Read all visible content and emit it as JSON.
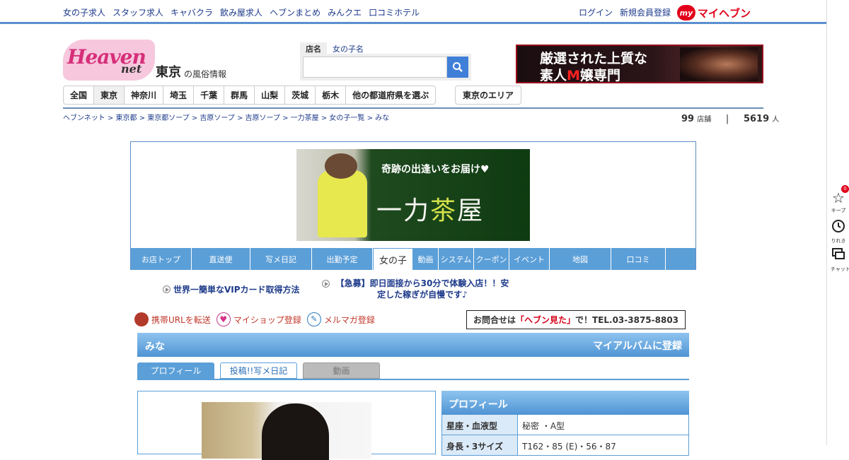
{
  "top_nav": {
    "links": [
      "女の子求人",
      "スタッフ求人",
      "キャバクラ",
      "飲み屋求人",
      "ヘブンまとめ",
      "みんクエ",
      "口コミホテル"
    ],
    "login": "ログイン",
    "register": "新規会員登録",
    "my_badge": "my",
    "my_heaven": "マイヘブン"
  },
  "header": {
    "logo_text": "Heaven",
    "logo_net": "net",
    "city": "東京",
    "city_sub": "の風俗情報",
    "search_tabs": [
      "店名",
      "女の子名"
    ],
    "search_placeholder": "",
    "ad_line1_a": "厳選された",
    "ad_line1_b": "上質な",
    "ad_line2_a": "素人",
    "ad_line2_b": "M",
    "ad_line2_c": "嬢専門"
  },
  "regions": {
    "items": [
      "全国",
      "東京",
      "神奈川",
      "埼玉",
      "千葉",
      "群馬",
      "山梨",
      "茨城",
      "栃木",
      "他の都道府県を選ぶ"
    ],
    "active": "東京",
    "area_button": "東京のエリア"
  },
  "breadcrumb": "ヘブンネット > 東京都 > 東京都ソープ > 吉原ソープ > 吉原ソープ > 一力茶屋 > 女の子一覧 > みな",
  "counts": {
    "shops": "99",
    "shops_unit": "店舗",
    "sep": "|",
    "people": "5619",
    "people_unit": "人"
  },
  "shop": {
    "tagline": "奇跡の出逢いをお届け♥",
    "name_a": "一力",
    "name_b": "茶",
    "name_c": "屋",
    "menu": [
      "お店トップ",
      "直送便",
      "写メ日記",
      "出勤予定",
      "女の子",
      "動画",
      "システム",
      "クーポン",
      "イベント",
      "地図",
      "口コミ"
    ],
    "active_menu": "女の子"
  },
  "announcements": {
    "vip": "世界一簡単なVIPカード取得方法",
    "urgent": "【急募】即日面接から30分で体験入店！！安定した稼ぎが自慢です♪"
  },
  "actions": {
    "mobile_url": "携帯URLを転送",
    "my_shop": "マイショップ登録",
    "mail_mag": "メルマガ登録",
    "contact_pre": "お問合せは",
    "contact_red": "「ヘブン見た」",
    "contact_post": "で！TEL.03-3875-8803"
  },
  "girl": {
    "name": "みな",
    "album": "マイアルバムに登録",
    "tabs": [
      "プロフィール",
      "投稿!!写メ日記",
      "動画"
    ]
  },
  "profile": {
    "title": "プロフィール",
    "rows": [
      {
        "key": "星座・血液型",
        "value": "秘密 ・A型"
      },
      {
        "key": "身長・3サイズ",
        "value": "T162・85 (E)・56・87"
      }
    ]
  },
  "side_icons": {
    "keep": "キープ",
    "keep_count": "0",
    "history": "りれき",
    "chat": "チャット"
  },
  "colors": {
    "accent": "#5b9fd8",
    "brand_red": "#e2001a",
    "link": "#1d3a8a"
  }
}
